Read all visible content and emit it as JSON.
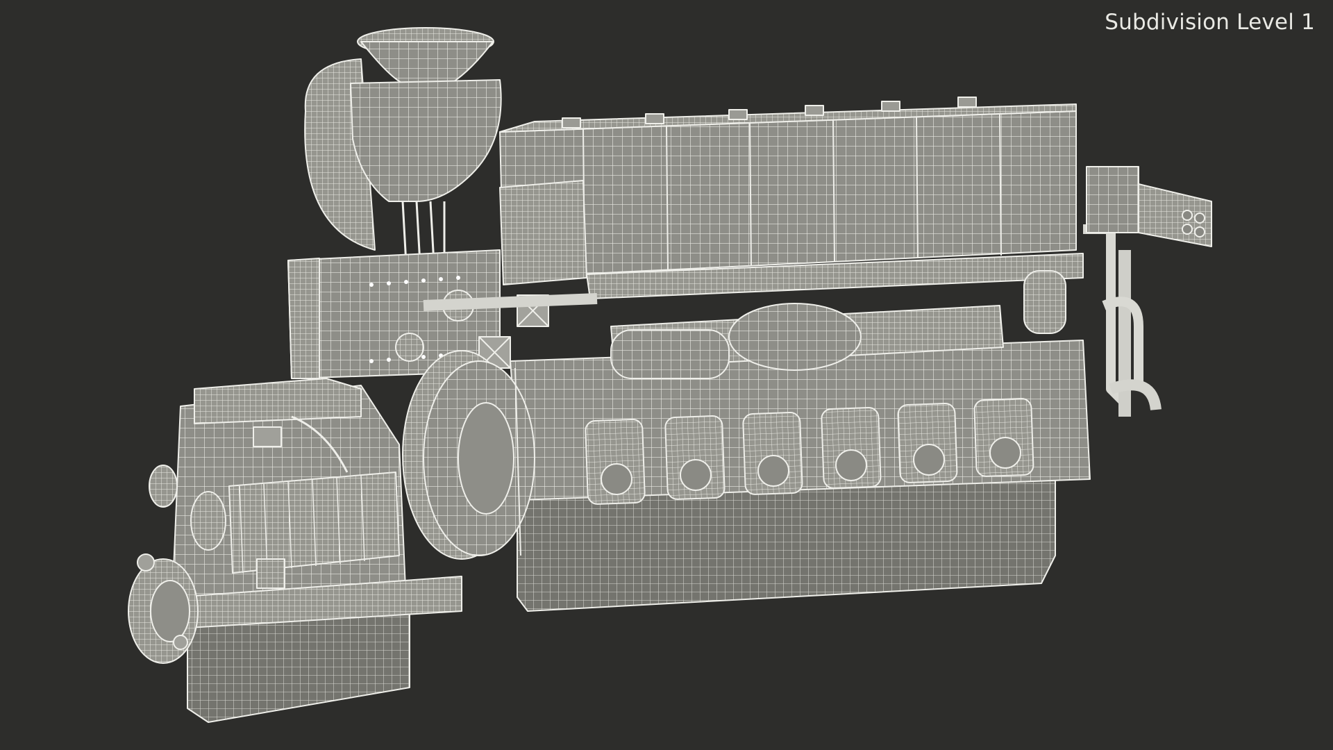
{
  "viewport": {
    "label": "Subdivision Level 1"
  },
  "model": {
    "icon": "wireframe-engine-icon"
  },
  "colors": {
    "background": "#2d2d2b",
    "mesh_face": "#8e8e88",
    "mesh_line": "#e8e8e2",
    "label": "#e9e9e4"
  }
}
